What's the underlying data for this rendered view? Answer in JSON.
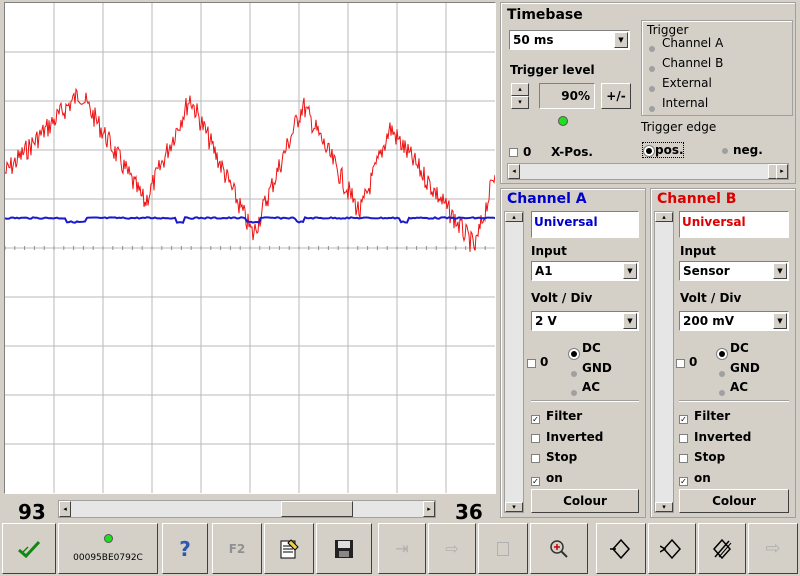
{
  "scope": {
    "left_value": "93",
    "right_value": "36",
    "trace_a_color": "#1a1acc",
    "trace_b_color": "#ee1111"
  },
  "timebase": {
    "title": "Timebase",
    "value": "50 ms",
    "trigger_level_label": "Trigger level",
    "trigger_level_value": "90",
    "trigger_level_unit": "%",
    "plus_minus": "+/-",
    "xpos_check": "0",
    "xpos_label": "X-Pos."
  },
  "trigger": {
    "title": "Trigger",
    "options": [
      "Channel A",
      "Channel B",
      "External",
      "Internal"
    ],
    "selected": "Internal",
    "edge_title": "Trigger edge",
    "edge_pos": "pos.",
    "edge_neg": "neg."
  },
  "channel_a": {
    "title": "Channel A",
    "name": "Universal",
    "input_label": "Input",
    "input_value": "A1",
    "volt_label": "Volt / Div",
    "volt_value": "2 V",
    "zero": "0",
    "coupling": [
      "DC",
      "GND",
      "AC"
    ],
    "filter": "Filter",
    "inverted": "Inverted",
    "stop": "Stop",
    "on": "on",
    "colour": "Colour",
    "color": "#0000cc"
  },
  "channel_b": {
    "title": "Channel B",
    "name": "Universal",
    "input_label": "Input",
    "input_value": "Sensor",
    "volt_label": "Volt / Div",
    "volt_value": "200 mV",
    "zero": "0",
    "coupling": [
      "DC",
      "GND",
      "AC"
    ],
    "filter": "Filter",
    "inverted": "Inverted",
    "stop": "Stop",
    "on": "on",
    "colour": "Colour",
    "color": "#dd0000"
  },
  "toolbar": {
    "device_id": "00095BE0792C",
    "f2": "F2"
  }
}
